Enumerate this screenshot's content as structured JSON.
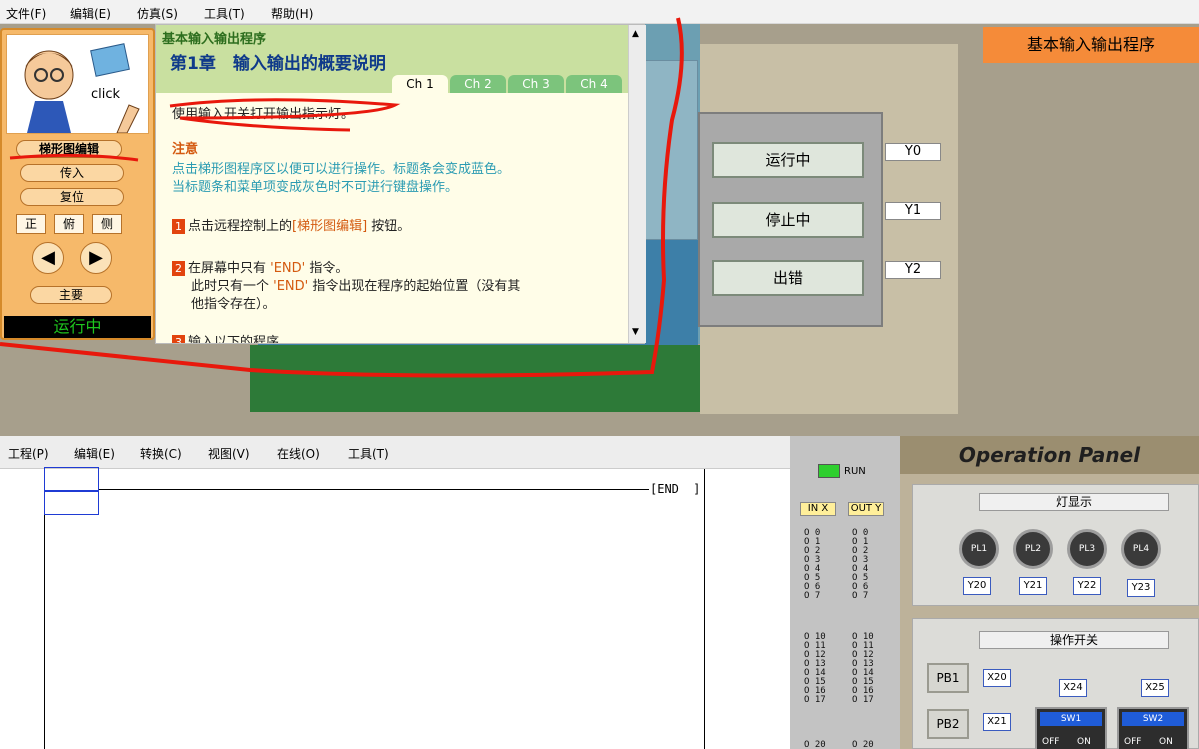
{
  "topmenu": {
    "items": [
      "文件(F)",
      "编辑(E)",
      "仿真(S)",
      "工具(T)",
      "帮助(H)"
    ]
  },
  "left_panel": {
    "click_label": "click",
    "buttons": [
      "梯形图编辑",
      "传入",
      "复位"
    ],
    "views": [
      "正",
      "俯",
      "侧"
    ],
    "main": "主要",
    "status": "运行中"
  },
  "doc": {
    "section": "基本输入输出程序",
    "chapter": "第1章　输入输出的概要说明",
    "tabs": [
      "Ch 1",
      "Ch 2",
      "Ch 3",
      "Ch 4"
    ],
    "intro": "使用输入开关打开输出指示灯。",
    "note_title": "注意",
    "note1": "点击梯形图程序区以便可以进行操作。标题条会变成蓝色。",
    "note2": "当标题条和菜单项变成灰色时不可进行键盘操作。",
    "step1_num": "1",
    "step1_a": "点击远程控制上的",
    "step1_b": "[梯形图编辑]",
    "step1_c": " 按钮。",
    "step2_num": "2",
    "step2_a": "在屏幕中只有 ",
    "step2_b": "'END'",
    "step2_c": " 指令。",
    "step2_d": "此时只有一个 ",
    "step2_e": "'END'",
    "step2_f": " 指令出现在程序的起始位置（没有其",
    "step2_g": "他指令存在）。",
    "step3": "输入以下的程序"
  },
  "status_box": {
    "buttons": [
      "运行中",
      "停止中",
      "出错"
    ],
    "outputs": [
      "Y0",
      "Y1",
      "Y2"
    ]
  },
  "scene_title": "基本输入输出程序",
  "editor": {
    "menu": [
      "工程(P)",
      "编辑(E)",
      "转换(C)",
      "视图(V)",
      "在线(O)",
      "工具(T)"
    ],
    "end_label": "[END"
  },
  "io": {
    "run": "RUN",
    "in_label": "IN X",
    "out_label": "OUT Y",
    "nums": [
      "0",
      "1",
      "2",
      "3",
      "4",
      "5",
      "6",
      "7",
      "10",
      "11",
      "12",
      "13",
      "14",
      "15",
      "16",
      "17",
      "20"
    ]
  },
  "op_panel": {
    "title": "Operation Panel",
    "lamps_title": "灯显示",
    "lamps": [
      "PL1",
      "PL2",
      "PL3",
      "PL4"
    ],
    "lamp_tags": [
      "Y20",
      "Y21",
      "Y22",
      "Y23"
    ],
    "switch_title": "操作开关",
    "pb1": "PB1",
    "pb1_tag": "X20",
    "pb2": "PB2",
    "pb2_tag": "X21",
    "x24": "X24",
    "x25": "X25",
    "sw1": "SW1",
    "sw2": "SW2",
    "off": "OFF",
    "on": "ON"
  }
}
